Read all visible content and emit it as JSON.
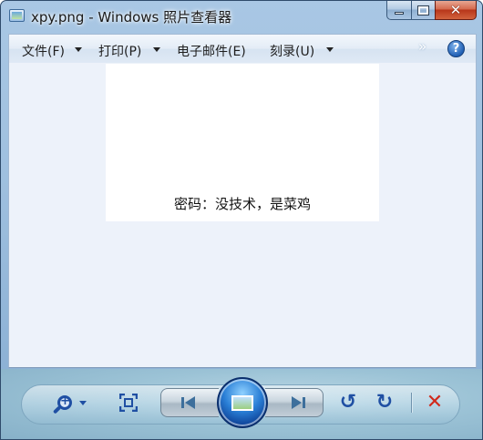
{
  "window": {
    "title": "xpy.png - Windows 照片查看器"
  },
  "menu": {
    "file": "文件(F)",
    "print": "打印(P)",
    "email": "电子邮件(E)",
    "burn": "刻录(U)",
    "overflow_glyph": "»",
    "help_glyph": "?"
  },
  "image": {
    "caption": "密码：没技术，是菜鸡"
  },
  "glyphs": {
    "close": "✕",
    "rotate_ccw": "↺",
    "rotate_cw": "↻",
    "delete": "✕"
  },
  "icons": {
    "app": "photo-viewer-icon",
    "zoom": "zoom-icon",
    "fit": "actual-size-icon",
    "prev": "previous-icon",
    "slideshow": "slideshow-icon",
    "next": "next-icon",
    "rotate_ccw": "rotate-counterclockwise-icon",
    "rotate_cw": "rotate-clockwise-icon",
    "delete": "delete-icon",
    "help": "help-icon"
  },
  "colors": {
    "accent": "#1f4fa3",
    "delete": "#d12a1c",
    "viewer_bg": "#edf2fa"
  }
}
